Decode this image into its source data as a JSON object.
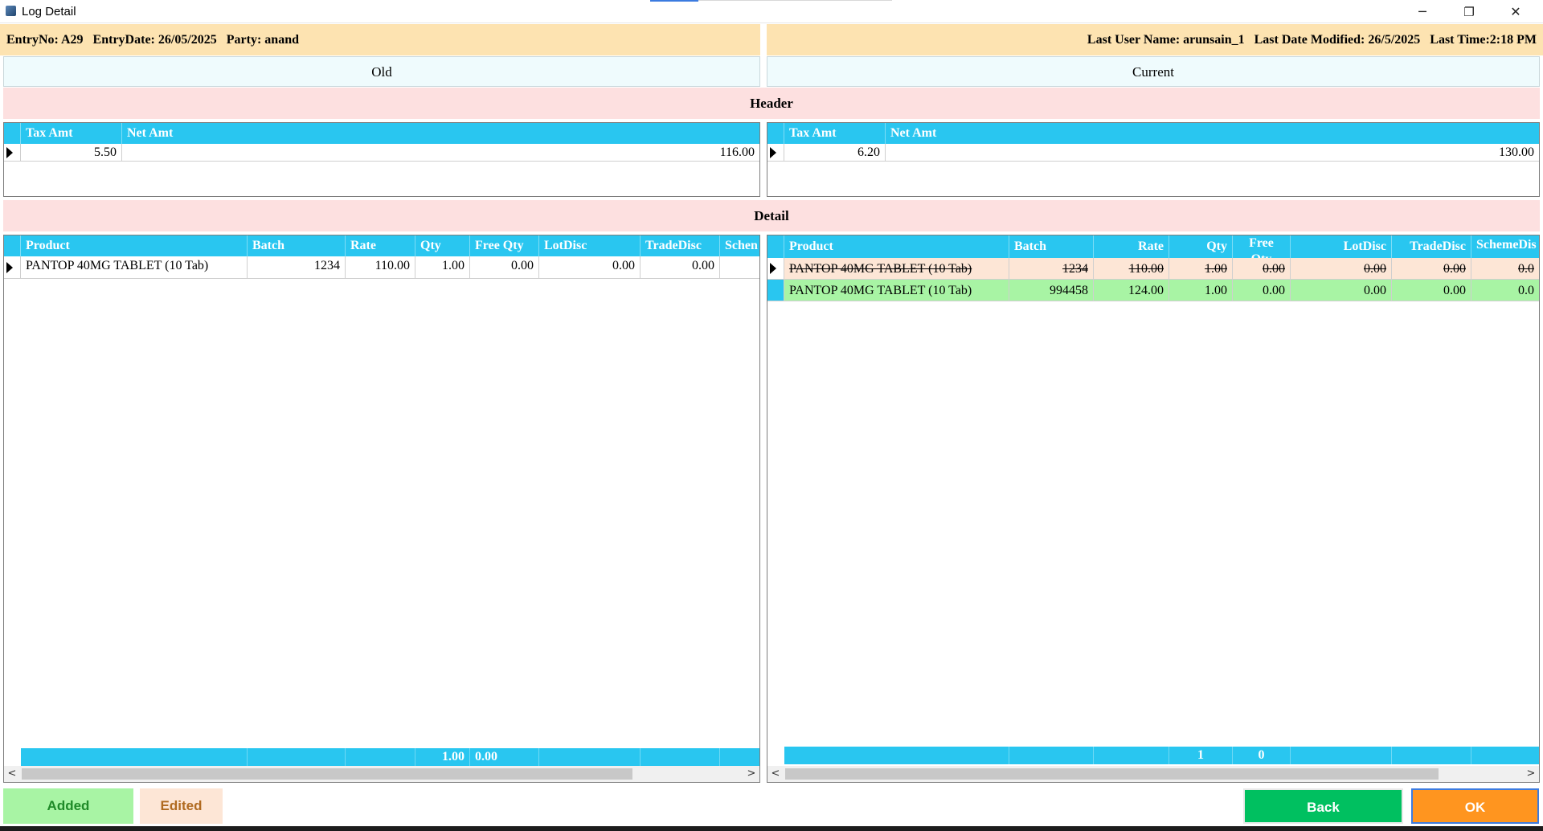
{
  "window": {
    "title": "Log Detail",
    "minimize": "─",
    "restore": "❐",
    "close": "✕"
  },
  "info": {
    "left": "EntryNo: A29   EntryDate: 26/05/2025   Party: anand",
    "right": "Last User Name: arunsain_1   Last Date Modified: 26/5/2025   Last Time:2:18 PM"
  },
  "columns": {
    "old": "Old",
    "current": "Current"
  },
  "bands": {
    "header": "Header",
    "detail": "Detail"
  },
  "header_grid": {
    "columns": [
      "Tax Amt",
      "Net Amt"
    ],
    "old": {
      "tax_amt": "5.50",
      "net_amt": "116.00"
    },
    "current": {
      "tax_amt": "6.20",
      "net_amt": "130.00"
    }
  },
  "detail_grid": {
    "old_columns": [
      "Product",
      "Batch",
      "Rate",
      "Qty",
      "Free Qty",
      "LotDisc",
      "TradeDisc",
      "Schen"
    ],
    "current_columns": [
      "Product",
      "Batch",
      "Rate",
      "Qty",
      "Free Qty",
      "LotDisc",
      "TradeDisc",
      "SchemeDis"
    ],
    "old_rows": [
      {
        "product": "PANTOP 40MG TABLET (10 Tab)",
        "batch": "1234",
        "rate": "110.00",
        "qty": "1.00",
        "free_qty": "0.00",
        "lotdisc": "0.00",
        "tradedisc": "0.00",
        "scheme": ""
      }
    ],
    "current_rows": [
      {
        "product": "PANTOP 40MG TABLET (10 Tab)",
        "batch": "1234",
        "rate": "110.00",
        "qty": "1.00",
        "free_qty": "0.00",
        "lotdisc": "0.00",
        "tradedisc": "0.00",
        "scheme": "0.0",
        "status": "edited"
      },
      {
        "product": "PANTOP 40MG TABLET (10 Tab)",
        "batch": "994458",
        "rate": "124.00",
        "qty": "1.00",
        "free_qty": "0.00",
        "lotdisc": "0.00",
        "tradedisc": "0.00",
        "scheme": "0.0",
        "status": "added"
      }
    ],
    "old_totals": {
      "qty": "1.00",
      "free_qty": "0.00"
    },
    "current_totals": {
      "qty": "1",
      "free_qty": "0"
    }
  },
  "legend": {
    "added": "Added",
    "edited": "Edited"
  },
  "buttons": {
    "back": "Back",
    "ok": "OK"
  },
  "colors": {
    "cyan_header": "#29c6f0",
    "edited_row": "#fde6d6",
    "added_row": "#a8f4a4",
    "back_button": "#00c060",
    "ok_button": "#ff951f"
  }
}
